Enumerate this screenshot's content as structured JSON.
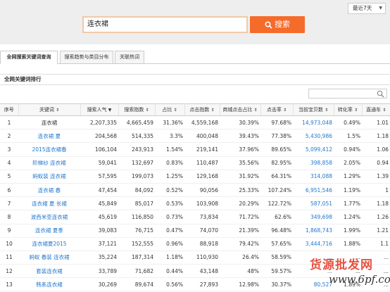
{
  "top": {
    "range_label": "最近7天",
    "search_value": "连衣裙",
    "search_button": "搜索"
  },
  "tabs": [
    {
      "label": "全网搜索关键词查询",
      "active": true
    },
    {
      "label": "搜索趋势与类目分布",
      "active": false
    },
    {
      "label": "关联热词",
      "active": false
    }
  ],
  "panel": {
    "title": "全网关键词排行",
    "filter_value": ""
  },
  "table": {
    "headers": [
      "序号",
      "关键词",
      "搜索人气",
      "搜索指数",
      "占比",
      "点击指数",
      "商城点击占比",
      "点击率",
      "当前宝贝数",
      "转化率",
      "直通车"
    ],
    "sorted_column": "搜索人气",
    "rows": [
      [
        "1",
        "连衣裙",
        "2,207,335",
        "4,665,459",
        "31.36%",
        "4,559,168",
        "30.39%",
        "97.68%",
        "14,973,048",
        "0.49%",
        "1.01"
      ],
      [
        "2",
        "连衣裙 夏",
        "204,568",
        "514,335",
        "3.3%",
        "400,048",
        "39.43%",
        "77.38%",
        "5,430,986",
        "1.5%",
        "1.18"
      ],
      [
        "3",
        "2015连衣裙春",
        "106,104",
        "243,913",
        "1.54%",
        "219,141",
        "37.96%",
        "89.65%",
        "5,099,412",
        "0.94%",
        "1.06"
      ],
      [
        "4",
        "阶梯纱 连衣裙",
        "59,041",
        "132,697",
        "0.83%",
        "110,487",
        "35.56%",
        "82.95%",
        "398,858",
        "2.05%",
        "0.94"
      ],
      [
        "5",
        "蚂蚁装 连衣裙",
        "57,595",
        "199,073",
        "1.25%",
        "129,168",
        "31.92%",
        "64.31%",
        "314,088",
        "1.29%",
        "1.39"
      ],
      [
        "6",
        "连衣裙 春",
        "47,454",
        "84,092",
        "0.52%",
        "90,056",
        "25.33%",
        "107.24%",
        "6,951,546",
        "1.19%",
        "1"
      ],
      [
        "7",
        "连衣裙 夏 长裙",
        "45,849",
        "85,017",
        "0.53%",
        "103,908",
        "20.29%",
        "122.72%",
        "587,051",
        "1.77%",
        "1.18"
      ],
      [
        "8",
        "波西米亚连衣裙",
        "45,619",
        "116,850",
        "0.73%",
        "73,834",
        "71.72%",
        "62.6%",
        "349,698",
        "1.24%",
        "1.26"
      ],
      [
        "9",
        "连衣裙 夏季",
        "39,083",
        "76,715",
        "0.47%",
        "74,070",
        "21.39%",
        "96.48%",
        "1,868,743",
        "1.99%",
        "1.21"
      ],
      [
        "10",
        "连衣裙夏2015",
        "37,121",
        "152,555",
        "0.96%",
        "88,918",
        "79.42%",
        "57.65%",
        "3,444,716",
        "1.88%",
        "1.1"
      ],
      [
        "11",
        "蚂蚁 春装 连衣裙",
        "35,224",
        "187,314",
        "1.18%",
        "110,930",
        "26.4%",
        "58.59%",
        "...",
        "...",
        "..."
      ],
      [
        "12",
        "套装连衣裙",
        "33,789",
        "71,682",
        "0.44%",
        "43,148",
        "48%",
        "59.57%",
        "...",
        "...",
        "..."
      ],
      [
        "13",
        "韩系连衣裙",
        "30,269",
        "89,674",
        "0.56%",
        "27,893",
        "12.98%",
        "30.37%",
        "80,527",
        "1.89%",
        "..."
      ]
    ]
  },
  "watermark": {
    "line1": "货源批发网",
    "line2": "www.6pf.com"
  },
  "colors": {
    "accent": "#f56b2a",
    "link": "#2277cc"
  }
}
